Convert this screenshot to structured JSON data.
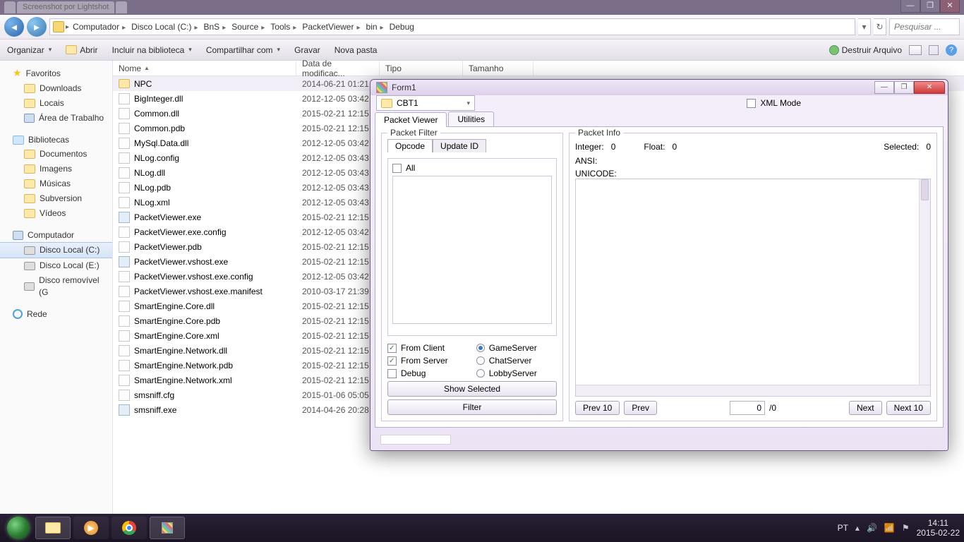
{
  "tabstrip": {
    "tabs": [
      "",
      "Screenshot por Lightshot",
      ""
    ]
  },
  "syswin": {
    "min": "—",
    "max": "❐",
    "close": "✕"
  },
  "explorer": {
    "breadcrumb": [
      "Computador",
      "Disco Local (C:)",
      "BnS",
      "Source",
      "Tools",
      "PacketViewer",
      "bin",
      "Debug"
    ],
    "search_placeholder": "Pesquisar ...",
    "toolbar": {
      "organize": "Organizar",
      "open": "Abrir",
      "include": "Incluir na biblioteca",
      "share": "Compartilhar com",
      "burn": "Gravar",
      "newfolder": "Nova pasta",
      "destroy": "Destruir Arquivo"
    },
    "columns": {
      "name": "Nome",
      "date": "Data de modificaç...",
      "type": "Tipo",
      "size": "Tamanho"
    },
    "sidebar": {
      "favorites": "Favoritos",
      "downloads": "Downloads",
      "places": "Locais",
      "desktop": "Área de Trabalho",
      "libraries": "Bibliotecas",
      "documents": "Documentos",
      "images": "Imagens",
      "music": "Músicas",
      "subversion": "Subversion",
      "videos": "Vídeos",
      "computer": "Computador",
      "diskc": "Disco Local (C:)",
      "diske": "Disco Local (E:)",
      "removable": "Disco removível (G",
      "network": "Rede"
    },
    "files": [
      {
        "name": "NPC",
        "date": "2014-06-21 01:21",
        "type": "folder"
      },
      {
        "name": "BigInteger.dll",
        "date": "2012-12-05 03:42",
        "type": "dll"
      },
      {
        "name": "Common.dll",
        "date": "2015-02-21 12:15",
        "type": "dll"
      },
      {
        "name": "Common.pdb",
        "date": "2015-02-21 12:15",
        "type": "doc"
      },
      {
        "name": "MySql.Data.dll",
        "date": "2012-12-05 03:42",
        "type": "dll"
      },
      {
        "name": "NLog.config",
        "date": "2012-12-05 03:43",
        "type": "cfg"
      },
      {
        "name": "NLog.dll",
        "date": "2012-12-05 03:43",
        "type": "dll"
      },
      {
        "name": "NLog.pdb",
        "date": "2012-12-05 03:43",
        "type": "doc"
      },
      {
        "name": "NLog.xml",
        "date": "2012-12-05 03:43",
        "type": "doc"
      },
      {
        "name": "PacketViewer.exe",
        "date": "2015-02-21 12:15",
        "type": "exe"
      },
      {
        "name": "PacketViewer.exe.config",
        "date": "2012-12-05 03:42",
        "type": "cfg"
      },
      {
        "name": "PacketViewer.pdb",
        "date": "2015-02-21 12:15",
        "type": "doc"
      },
      {
        "name": "PacketViewer.vshost.exe",
        "date": "2015-02-21 12:15",
        "type": "exe"
      },
      {
        "name": "PacketViewer.vshost.exe.config",
        "date": "2012-12-05 03:42",
        "type": "cfg"
      },
      {
        "name": "PacketViewer.vshost.exe.manifest",
        "date": "2010-03-17 21:39",
        "type": "doc"
      },
      {
        "name": "SmartEngine.Core.dll",
        "date": "2015-02-21 12:15",
        "type": "dll"
      },
      {
        "name": "SmartEngine.Core.pdb",
        "date": "2015-02-21 12:15",
        "type": "doc"
      },
      {
        "name": "SmartEngine.Core.xml",
        "date": "2015-02-21 12:15",
        "type": "doc"
      },
      {
        "name": "SmartEngine.Network.dll",
        "date": "2015-02-21 12:15",
        "type": "dll"
      },
      {
        "name": "SmartEngine.Network.pdb",
        "date": "2015-02-21 12:15",
        "type": "doc"
      },
      {
        "name": "SmartEngine.Network.xml",
        "date": "2015-02-21 12:15",
        "type": "doc"
      },
      {
        "name": "smsniff.cfg",
        "date": "2015-01-06 05:05",
        "type": "cfg"
      },
      {
        "name": "smsniff.exe",
        "date": "2014-04-26 20:28",
        "type": "exe"
      }
    ]
  },
  "form1": {
    "title": "Form1",
    "combo": "CBT1",
    "xmlmode": "XML Mode",
    "tabs": {
      "pv": "Packet Viewer",
      "util": "Utilities"
    },
    "filter": {
      "legend": "Packet Filter",
      "subtabs": {
        "opcode": "Opcode",
        "update": "Update ID"
      },
      "all": "All",
      "fromclient": "From Client",
      "fromserver": "From Server",
      "debug": "Debug",
      "gameserver": "GameServer",
      "chatserver": "ChatServer",
      "lobbyserver": "LobbyServer",
      "showsel": "Show Selected",
      "filterbtn": "Filter"
    },
    "info": {
      "legend": "Packet Info",
      "integer_l": "Integer:",
      "integer_v": "0",
      "float_l": "Float:",
      "float_v": "0",
      "selected_l": "Selected:",
      "selected_v": "0",
      "ansi": "ANSI:",
      "unicode": "UNICODE:",
      "prev10": "Prev 10",
      "prev": "Prev",
      "page": "0",
      "total": "/0",
      "next": "Next",
      "next10": "Next 10"
    }
  },
  "taskbar": {
    "lang": "PT",
    "time": "14:11",
    "date": "2015-02-22"
  }
}
